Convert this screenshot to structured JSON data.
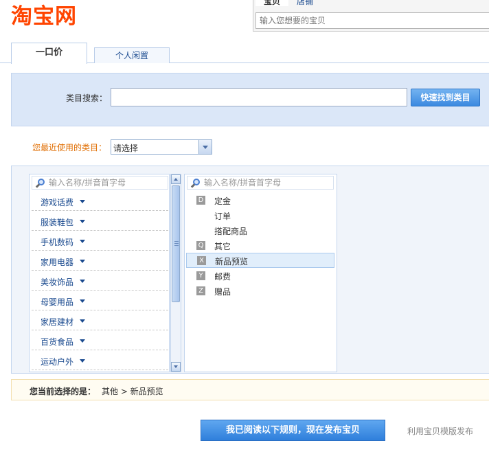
{
  "header": {
    "logo": "淘宝网",
    "search_tabs": [
      "宝贝",
      "店铺"
    ],
    "search_placeholder": "输入您想要的宝贝"
  },
  "tabs": {
    "fixed_price": "一口价",
    "personal_idle": "个人闲置"
  },
  "category_search": {
    "label": "类目搜索：",
    "input_value": "",
    "button": "快速找到类目"
  },
  "recent": {
    "label": "您最近使用的类目：",
    "selected": "请选择"
  },
  "level1": {
    "filter_placeholder": "输入名称/拼音首字母",
    "items": [
      {
        "label": "游戏话费"
      },
      {
        "label": "服装鞋包"
      },
      {
        "label": "手机数码"
      },
      {
        "label": "家用电器"
      },
      {
        "label": "美妆饰品"
      },
      {
        "label": "母婴用品"
      },
      {
        "label": "家居建材"
      },
      {
        "label": "百货食品"
      },
      {
        "label": "运动户外"
      }
    ]
  },
  "level2": {
    "filter_placeholder": "输入名称/拼音首字母",
    "items": [
      {
        "letter": "D",
        "label": "定金"
      },
      {
        "letter": "",
        "label": "订单"
      },
      {
        "letter": "",
        "label": "搭配商品"
      },
      {
        "letter": "Q",
        "label": "其它"
      },
      {
        "letter": "X",
        "label": "新品预览",
        "selected": true
      },
      {
        "letter": "Y",
        "label": "邮费"
      },
      {
        "letter": "Z",
        "label": "赠品"
      }
    ]
  },
  "current_selection": {
    "label": "您当前选择的是：",
    "value": "其他 > 新品预览"
  },
  "footer": {
    "publish_button": "我已阅读以下规则，现在发布宝贝",
    "template_link": "利用宝贝模版发布"
  },
  "colors": {
    "logo": "#ff4400",
    "link": "#1a4a8f",
    "accent_orange": "#e06d00",
    "button_blue": "#3b89e0",
    "band_bg": "#dbe7f8"
  }
}
